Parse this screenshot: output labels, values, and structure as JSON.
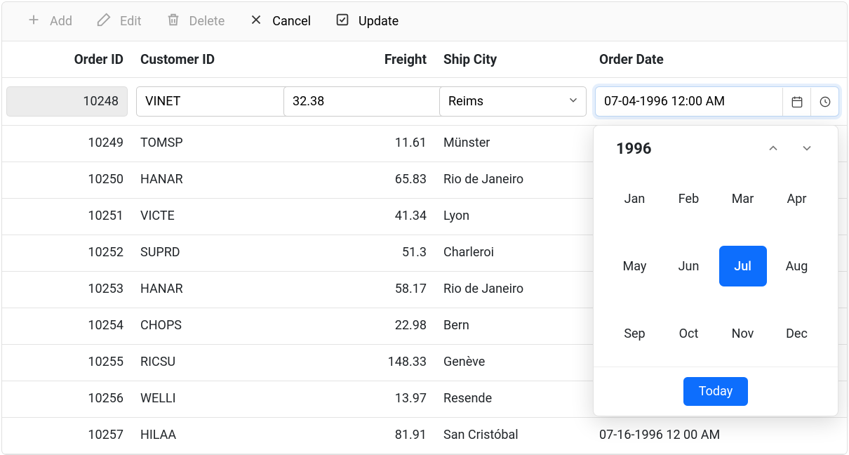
{
  "toolbar": {
    "add": "Add",
    "edit": "Edit",
    "delete": "Delete",
    "cancel": "Cancel",
    "update": "Update"
  },
  "columns": {
    "order_id": "Order ID",
    "customer_id": "Customer ID",
    "freight": "Freight",
    "ship_city": "Ship City",
    "order_date": "Order Date"
  },
  "editRow": {
    "order_id": "10248",
    "customer_id": "VINET",
    "freight": "32.38",
    "ship_city": "Reims",
    "order_date": "07-04-1996 12:00 AM"
  },
  "rows": [
    {
      "order_id": "10249",
      "customer_id": "TOMSP",
      "freight": "11.61",
      "ship_city": "Münster",
      "order_date": ""
    },
    {
      "order_id": "10250",
      "customer_id": "HANAR",
      "freight": "65.83",
      "ship_city": "Rio de Janeiro",
      "order_date": ""
    },
    {
      "order_id": "10251",
      "customer_id": "VICTE",
      "freight": "41.34",
      "ship_city": "Lyon",
      "order_date": ""
    },
    {
      "order_id": "10252",
      "customer_id": "SUPRD",
      "freight": "51.3",
      "ship_city": "Charleroi",
      "order_date": ""
    },
    {
      "order_id": "10253",
      "customer_id": "HANAR",
      "freight": "58.17",
      "ship_city": "Rio de Janeiro",
      "order_date": ""
    },
    {
      "order_id": "10254",
      "customer_id": "CHOPS",
      "freight": "22.98",
      "ship_city": "Bern",
      "order_date": ""
    },
    {
      "order_id": "10255",
      "customer_id": "RICSU",
      "freight": "148.33",
      "ship_city": "Genève",
      "order_date": ""
    },
    {
      "order_id": "10256",
      "customer_id": "WELLI",
      "freight": "13.97",
      "ship_city": "Resende",
      "order_date": ""
    },
    {
      "order_id": "10257",
      "customer_id": "HILAA",
      "freight": "81.91",
      "ship_city": "San Cristóbal",
      "order_date": "07-16-1996 12 00 AM"
    }
  ],
  "calendar": {
    "year": "1996",
    "months": [
      "Jan",
      "Feb",
      "Mar",
      "Apr",
      "May",
      "Jun",
      "Jul",
      "Aug",
      "Sep",
      "Oct",
      "Nov",
      "Dec"
    ],
    "selected_index": 6,
    "today_label": "Today"
  }
}
